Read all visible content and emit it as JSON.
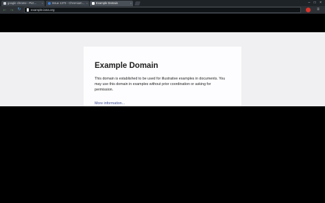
{
  "window": {
    "tabs": [
      {
        "title": "google chrome - Pict…",
        "close": "×"
      },
      {
        "title": "Issue 1373 - Chromium…",
        "close": "×"
      },
      {
        "title": "Example Domain",
        "close": "×"
      }
    ],
    "controls": "– □ ×"
  },
  "toolbar": {
    "back": "←",
    "forward": "→",
    "reload": "↻",
    "url": "example.iana.org",
    "menu": "≡"
  },
  "page": {
    "heading": "Example Domain",
    "body": "This domain is established to be used for illustrative examples in documents. You may use this domain in examples without prior coordination or asking for permission.",
    "link": "More information..."
  },
  "colors": {
    "page_background": "#f0f0f2",
    "card_background": "#fdfdff",
    "link": "#38488f",
    "nav_arrows": "#6cc04a",
    "reload": "#4aa3e6",
    "extension": "#d9342b"
  },
  "icons": {
    "back": "back-arrow-icon",
    "forward": "forward-arrow-icon",
    "reload": "reload-icon",
    "page": "page-icon",
    "extension": "extension-icon",
    "menu": "menu-icon"
  }
}
